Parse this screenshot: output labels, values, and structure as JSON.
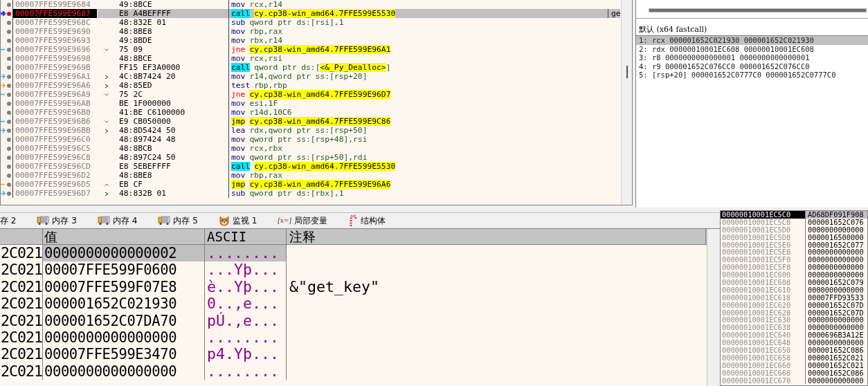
{
  "disassembly": {
    "rows": [
      {
        "address": "00007FFE599E9684",
        "bytes": "49:8BCE",
        "kind": "none",
        "instruction": {
          "kind": "plain",
          "mnemonic": "mov",
          "operands": "rcx,r14"
        },
        "selected": false,
        "breakpoint": false
      },
      {
        "address": "00007FFE599E9687",
        "bytes": "E8 A4BEFFFF",
        "kind": "ip",
        "instruction": {
          "kind": "call",
          "mnemonic": "call",
          "target": "cy.cp38-win_amd64.7FFE599E5530"
        },
        "comment": "ge",
        "selected": true,
        "breakpoint": true
      },
      {
        "address": "00007FFE599E968C",
        "bytes": "48:832E 01",
        "kind": "none",
        "instruction": {
          "kind": "plain",
          "mnemonic": "sub",
          "operands": "qword ptr ds:[rsi],1"
        },
        "selected": false,
        "breakpoint": false
      },
      {
        "address": "00007FFE599E9690",
        "bytes": "48:8BE8",
        "kind": "none",
        "instruction": {
          "kind": "plain",
          "mnemonic": "mov",
          "operands": "rbp,rax"
        },
        "selected": false,
        "breakpoint": false
      },
      {
        "address": "00007FFE599E9693",
        "bytes": "49:8BDE",
        "kind": "none",
        "instruction": {
          "kind": "plain",
          "mnemonic": "mov",
          "operands": "rbx,r14"
        },
        "selected": false,
        "breakpoint": false
      },
      {
        "address": "00007FFE599E9696",
        "bytes": "75 09",
        "kind": "down",
        "instruction": {
          "kind": "jcc",
          "mnemonic": "jne",
          "target": "cy.cp38-win_amd64.7FFE599E96A1"
        },
        "selected": false,
        "breakpoint": false
      },
      {
        "address": "00007FFE599E9698",
        "bytes": "48:8BCE",
        "kind": "none",
        "instruction": {
          "kind": "plain",
          "mnemonic": "mov",
          "operands": "rcx,rsi"
        },
        "selected": false,
        "breakpoint": false
      },
      {
        "address": "00007FFE599E969B",
        "bytes": "FF15 EF3A0000",
        "kind": "none",
        "instruction": {
          "kind": "call",
          "mnemonic": "call",
          "operands": "qword ptr ds:[",
          "target": "<&_Py_Dealloc>",
          "suffix": "]"
        },
        "selected": false,
        "breakpoint": false
      },
      {
        "address": "00007FFE599E96A1",
        "bytes": "4C:8B7424 20",
        "kind": "target",
        "instruction": {
          "kind": "plain",
          "mnemonic": "mov",
          "operands": "r14,qword ptr ss:[rsp+20]"
        },
        "selected": false,
        "breakpoint": false
      },
      {
        "address": "00007FFE599E96A6",
        "bytes": "48:85ED",
        "kind": "target_up",
        "instruction": {
          "kind": "plain",
          "mnemonic": "test",
          "operands": "rbp,rbp"
        },
        "selected": false,
        "breakpoint": false
      },
      {
        "address": "00007FFE599E96A9",
        "bytes": "75 2C",
        "kind": "down",
        "instruction": {
          "kind": "jcc",
          "mnemonic": "jne",
          "target": "cy.cp38-win_amd64.7FFE599E96D7"
        },
        "selected": false,
        "breakpoint": false
      },
      {
        "address": "00007FFE599E96AB",
        "bytes": "BE 1F000000",
        "kind": "none",
        "instruction": {
          "kind": "plain",
          "mnemonic": "mov",
          "operands": "esi,1F"
        },
        "selected": false,
        "breakpoint": false
      },
      {
        "address": "00007FFE599E96B0",
        "bytes": "41:BE C6100000",
        "kind": "none",
        "instruction": {
          "kind": "plain",
          "mnemonic": "mov",
          "operands": "r14d,10C6"
        },
        "selected": false,
        "breakpoint": false
      },
      {
        "address": "00007FFE599E96B6",
        "bytes": "E9 CB050000",
        "kind": "down",
        "instruction": {
          "kind": "jmp",
          "mnemonic": "jmp",
          "target": "cy.cp38-win_amd64.7FFE599E9C86"
        },
        "selected": false,
        "breakpoint": false
      },
      {
        "address": "00007FFE599E96BB",
        "bytes": "48:8D5424 50",
        "kind": "target",
        "instruction": {
          "kind": "plain",
          "mnemonic": "lea",
          "operands": "rdx,qword ptr ss:[rsp+50]"
        },
        "selected": false,
        "breakpoint": false
      },
      {
        "address": "00007FFE599E96C0",
        "bytes": "48:897424 48",
        "kind": "none",
        "instruction": {
          "kind": "plain",
          "mnemonic": "mov",
          "operands": "qword ptr ss:[rsp+48],rsi"
        },
        "selected": false,
        "breakpoint": false
      },
      {
        "address": "00007FFE599E96C5",
        "bytes": "48:8BCB",
        "kind": "none",
        "instruction": {
          "kind": "plain",
          "mnemonic": "mov",
          "operands": "rcx,rbx"
        },
        "selected": false,
        "breakpoint": false
      },
      {
        "address": "00007FFE599E96C8",
        "bytes": "48:897C24 50",
        "kind": "none",
        "instruction": {
          "kind": "plain",
          "mnemonic": "mov",
          "operands": "qword ptr ss:[rsp+50],rdi"
        },
        "selected": false,
        "breakpoint": false
      },
      {
        "address": "00007FFE599E96CD",
        "bytes": "E8 5EBEFFFF",
        "kind": "none",
        "instruction": {
          "kind": "call",
          "mnemonic": "call",
          "target": "cy.cp38-win_amd64.7FFE599E5530"
        },
        "selected": false,
        "breakpoint": false
      },
      {
        "address": "00007FFE599E96D2",
        "bytes": "48:8BE8",
        "kind": "none",
        "instruction": {
          "kind": "plain",
          "mnemonic": "mov",
          "operands": "rbp,rax"
        },
        "selected": false,
        "breakpoint": false
      },
      {
        "address": "00007FFE599E96D5",
        "bytes": "EB CF",
        "kind": "up",
        "instruction": {
          "kind": "jmp",
          "mnemonic": "jmp",
          "target": "cy.cp38-win_amd64.7FFE599E96A6"
        },
        "selected": false,
        "breakpoint": false
      },
      {
        "address": "00007FFE599E96D7",
        "bytes": "48:832B 01",
        "kind": "target",
        "instruction": {
          "kind": "plain",
          "mnemonic": "sub",
          "operands": "qword ptr ds:[rbx],1"
        },
        "selected": false,
        "breakpoint": false
      }
    ]
  },
  "call_args": {
    "header": "默认 (x64 fastcall)",
    "rows": [
      {
        "text": "1: rcx 000001652C021930 000001652C021930",
        "selected": true
      },
      {
        "text": "2: rdx 00000010001EC608 00000010001EC608",
        "selected": false
      },
      {
        "text": "3: r8 0000000000000001 0000000000000001",
        "selected": false
      },
      {
        "text": "4: r9 000001652C076CC0 000001652C076CC0",
        "selected": false
      },
      {
        "text": "5: [rsp+20] 000001652C0777C0 000001652C0777C0",
        "selected": false
      }
    ]
  },
  "tabs": [
    {
      "label": "存 2",
      "selected": false
    },
    {
      "kind": "memory",
      "label": "内存 3",
      "selected": false
    },
    {
      "kind": "memory",
      "label": "内存 4",
      "selected": false
    },
    {
      "kind": "memory",
      "label": "内存 5",
      "selected": false
    },
    {
      "kind": "watch",
      "label": "监视 1",
      "selected": false
    },
    {
      "kind": "locals",
      "glyph": "[x=]",
      "label": "局部变量",
      "selected": false
    },
    {
      "kind": "struct",
      "label": "结构体",
      "selected": false
    }
  ],
  "dump": {
    "columns": [
      "值",
      "ASCII",
      "注释"
    ],
    "rows": [
      {
        "address": "2C021",
        "value": "0000000000000002",
        "ascii": "........",
        "selected": true
      },
      {
        "address": "2C021",
        "value": "00007FFE599F0600",
        "ascii": "...Yþ...",
        "selected": false
      },
      {
        "address": "2C021",
        "value": "00007FFE599F07E8",
        "ascii": "è..Yþ...",
        "comment": "&\"get_key\"",
        "selected": false
      },
      {
        "address": "2C021",
        "value": "000001652C021930",
        "ascii": "0..,e...",
        "selected": false
      },
      {
        "address": "2C021",
        "value": "000001652C07DA70",
        "ascii": "pÚ.,e...",
        "selected": false
      },
      {
        "address": "2C021",
        "value": "0000000000000000",
        "ascii": "........",
        "selected": false
      },
      {
        "address": "2C021",
        "value": "00007FFE599E3470",
        "ascii": "p4.Yþ...",
        "selected": false
      },
      {
        "address": "2C021",
        "value": "0000000000000000",
        "ascii": "........",
        "selected": false
      }
    ]
  },
  "stack": {
    "rows": [
      {
        "address": "00000010001EC5C0",
        "value": "AD68DF091F908",
        "selected": true
      },
      {
        "address": "00000010001EC5C8",
        "value": "000001652C076",
        "selected": false
      },
      {
        "address": "00000010001EC5D0",
        "value": "0000000000000",
        "selected": false
      },
      {
        "address": "00000010001EC5D8",
        "value": "0000016500000",
        "selected": false
      },
      {
        "address": "00000010001EC5E0",
        "value": "000001652C077",
        "selected": false
      },
      {
        "address": "00000010001EC5E8",
        "value": "0000000000000",
        "selected": false
      },
      {
        "address": "00000010001EC5F0",
        "value": "0000000000000",
        "selected": false
      },
      {
        "address": "00000010001EC5F8",
        "value": "0000000000000",
        "selected": false
      },
      {
        "address": "00000010001EC600",
        "value": "0000000000000",
        "selected": false
      },
      {
        "address": "00000010001EC608",
        "value": "000001652C079",
        "selected": false
      },
      {
        "address": "00000010001EC610",
        "value": "0000000000000",
        "selected": false
      },
      {
        "address": "00000010001EC618",
        "value": "00007FFD93533",
        "selected": false
      },
      {
        "address": "00000010001EC620",
        "value": "000001652C07D",
        "selected": false
      },
      {
        "address": "00000010001EC628",
        "value": "000001652C07D",
        "selected": false
      },
      {
        "address": "00000010001EC630",
        "value": "0000000000000",
        "selected": false
      },
      {
        "address": "00000010001EC638",
        "value": "0000000000000",
        "selected": false
      },
      {
        "address": "00000010001EC640",
        "value": "0000696B3A12E",
        "selected": false
      },
      {
        "address": "00000010001EC648",
        "value": "0000000000000",
        "selected": false
      },
      {
        "address": "00000010001EC650",
        "value": "000001652C086",
        "selected": false
      },
      {
        "address": "00000010001EC658",
        "value": "000001652C021",
        "selected": false
      },
      {
        "address": "00000010001EC660",
        "value": "000001652C021",
        "selected": false
      },
      {
        "address": "00000010001EC668",
        "value": "000001652C086",
        "selected": false
      },
      {
        "address": "00000010001EC670",
        "value": "0000000000000",
        "selected": false
      }
    ]
  }
}
